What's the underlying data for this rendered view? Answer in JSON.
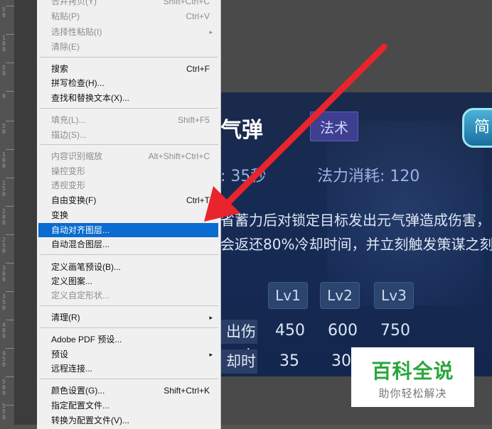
{
  "ruler": {
    "labels": [
      "5 0",
      "1 0 0",
      "5 0",
      "0",
      "5 0",
      "1 0 0",
      "1 5 0",
      "2 0 0",
      "2 5 0",
      "3 0 0",
      "3 5 0",
      "4 0 0",
      "4 5 0",
      "5 0 0",
      "5 5 0"
    ]
  },
  "menu": {
    "items": [
      {
        "label": "合并拷贝(Y)",
        "shortcut": "Shift+Ctrl+C",
        "disabled": true
      },
      {
        "label": "粘贴(P)",
        "shortcut": "Ctrl+V",
        "disabled": true
      },
      {
        "label": "选择性粘贴(I)",
        "submenu": "▸",
        "disabled": true
      },
      {
        "label": "清除(E)",
        "disabled": true
      },
      {
        "label": "搜索",
        "shortcut": "Ctrl+F",
        "disabled": false
      },
      {
        "label": "拼写检查(H)...",
        "disabled": false
      },
      {
        "label": "查找和替换文本(X)...",
        "disabled": false
      },
      {
        "label": "填充(L)...",
        "shortcut": "Shift+F5",
        "disabled": true
      },
      {
        "label": "描边(S)...",
        "disabled": true
      },
      {
        "label": "内容识别缩放",
        "shortcut": "Alt+Shift+Ctrl+C",
        "disabled": true
      },
      {
        "label": "操控变形",
        "disabled": true
      },
      {
        "label": "透视变形",
        "disabled": true
      },
      {
        "label": "自由变换(F)",
        "shortcut": "Ctrl+T",
        "disabled": false
      },
      {
        "label": "变换",
        "disabled": false
      },
      {
        "label": "自动对齐图层...",
        "disabled": false,
        "highlighted": true
      },
      {
        "label": "自动混合图层...",
        "disabled": false
      },
      {
        "label": "定义画笔预设(B)...",
        "disabled": false
      },
      {
        "label": "定义图案...",
        "disabled": false
      },
      {
        "label": "定义自定形状...",
        "disabled": true
      },
      {
        "label": "清理(R)",
        "submenu": "▸",
        "disabled": false
      },
      {
        "label": "Adobe PDF 预设...",
        "disabled": false
      },
      {
        "label": "预设",
        "submenu": "▸",
        "disabled": false
      },
      {
        "label": "远程连接...",
        "disabled": false
      },
      {
        "label": "颜色设置(G)...",
        "shortcut": "Shift+Ctrl+K",
        "disabled": false
      },
      {
        "label": "指定配置文件...",
        "disabled": false
      },
      {
        "label": "转换为配置文件(V)...",
        "disabled": false
      }
    ]
  },
  "canvas": {
    "skill_name": "气弹",
    "skill_tag": "法术",
    "tab_label": "简",
    "cooldown": ": 35秒",
    "mana": "法力消耗: 120",
    "description_line1": "省蓄力后对锁定目标发出元气弹造成伤害，目标已",
    "description_line2": "会返还80%冷却时间，并立刻触发策谋之刻。",
    "levels": [
      "Lv1",
      "Lv2",
      "Lv3"
    ],
    "row1_label": "出伤害",
    "row1_values": [
      "450",
      "600",
      "750"
    ],
    "row2_label": "却时间",
    "row2_values": [
      "35",
      "30"
    ]
  },
  "watermark": {
    "title": "百科全说",
    "subtitle": "助你轻松解决"
  },
  "colors": {
    "highlight": "#0a6bd0",
    "arrow": "#e8242c",
    "watermark_green": "#2aa63c"
  }
}
